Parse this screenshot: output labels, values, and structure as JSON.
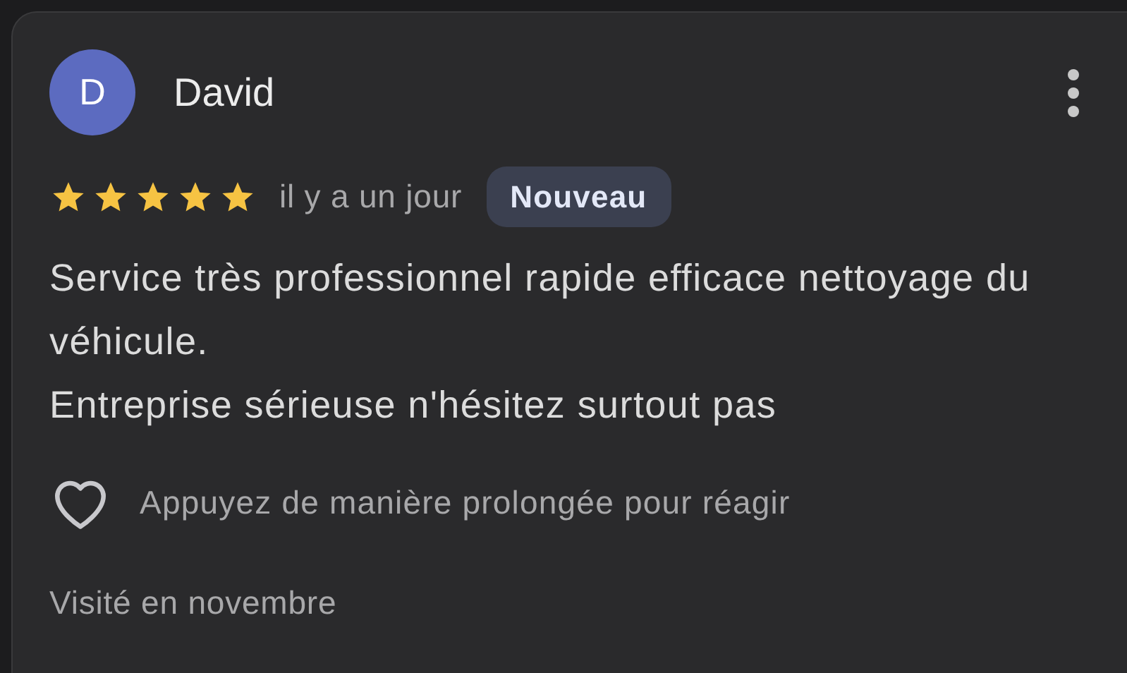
{
  "review": {
    "initial": "D",
    "name": "David",
    "stars": 5,
    "time": "il y a un jour",
    "badge": "Nouveau",
    "body": [
      "Service très professionnel rapide efficace nettoyage du véhicule.",
      "Entreprise sérieuse n'hésitez surtout pas"
    ],
    "reaction_hint": "Appuyez de manière prolongée pour réagir",
    "visited": "Visité en novembre"
  }
}
